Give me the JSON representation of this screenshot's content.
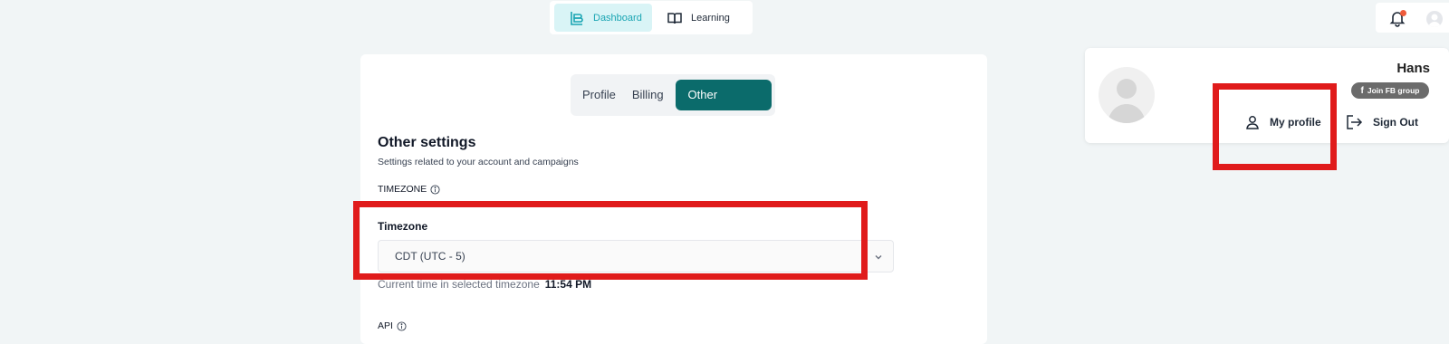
{
  "nav": {
    "items": [
      {
        "label": "Dashboard",
        "icon": "dashboard-icon",
        "active": true
      },
      {
        "label": "Learning",
        "icon": "book-icon",
        "active": false
      }
    ]
  },
  "header": {
    "notification_icon": "bell-icon",
    "avatar_icon": "user-avatar"
  },
  "settings": {
    "tabs": [
      {
        "label": "Profile",
        "active": false
      },
      {
        "label": "Billing",
        "active": false
      },
      {
        "label": "Other settings",
        "active": true
      }
    ],
    "title": "Other settings",
    "subtitle": "Settings related to your account and campaigns",
    "timezone_section_heading": "TIMEZONE",
    "timezone_field_label": "Timezone",
    "timezone_value": "CDT (UTC - 5)",
    "current_time_label": "Current time in selected timezone",
    "current_time_value": "11:54 PM",
    "api_section_heading": "API"
  },
  "profile_menu": {
    "name": "Hans",
    "fb_button_label": "Join FB group",
    "my_profile_label": "My profile",
    "sign_out_label": "Sign Out"
  },
  "colors": {
    "accent": "#0b6b6b",
    "nav_active_bg": "#d9f4f6",
    "nav_active_text": "#1aa5b3",
    "annotation_red": "#e01b1b",
    "page_bg": "#f1f5f6"
  }
}
